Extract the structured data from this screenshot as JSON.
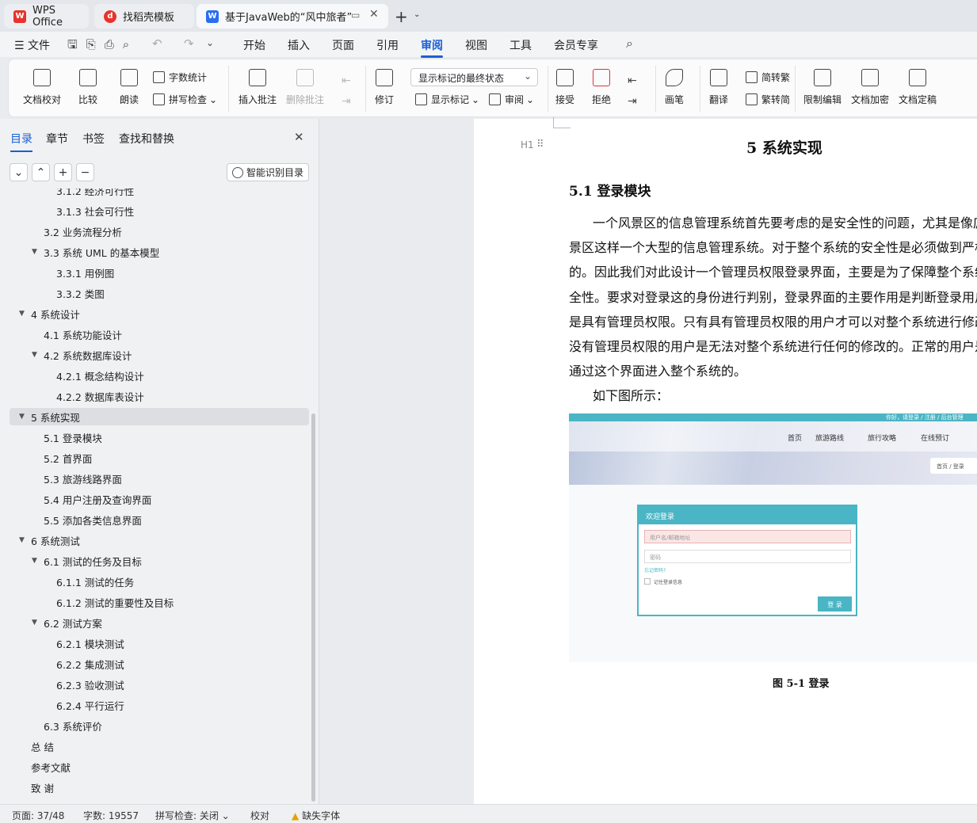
{
  "tabs": [
    {
      "label": "WPS Office"
    },
    {
      "label": "找稻壳模板"
    },
    {
      "label": "基于JavaWeb的“风中旅者”"
    }
  ],
  "menubar": {
    "file": "文件",
    "items": [
      "开始",
      "插入",
      "页面",
      "引用",
      "审阅",
      "视图",
      "工具",
      "会员专享"
    ],
    "selected": "审阅"
  },
  "ribbon": {
    "doc_check": "文档校对",
    "compare": "比较",
    "read_aloud": "朗读",
    "word_count": "字数统计",
    "spell_check": "拼写检查",
    "insert_comment": "插入批注",
    "delete_comment": "删除批注",
    "revise": "修订",
    "display_state": "显示标记的最终状态",
    "show_markup": "显示标记",
    "review": "审阅",
    "accept": "接受",
    "reject": "拒绝",
    "draw": "画笔",
    "translate": "翻译",
    "to_traditional": "简转繁",
    "to_simplified": "繁转简",
    "restrict_edit": "限制编辑",
    "encrypt": "文档加密",
    "finalize": "文档定稿"
  },
  "sidebar": {
    "tabs": [
      "目录",
      "章节",
      "书签",
      "查找和替换"
    ],
    "smart_toc": "智能识别目录",
    "toc": [
      {
        "label": "3.1.2  经济可行性",
        "level": 3
      },
      {
        "label": "3.1.3  社会可行性",
        "level": 3
      },
      {
        "label": "3.2  业务流程分析",
        "level": 2
      },
      {
        "label": "3.3  系统 UML 的基本模型",
        "level": 2,
        "expanded": true
      },
      {
        "label": "3.3.1  用例图",
        "level": 3
      },
      {
        "label": "3.3.2  类图",
        "level": 3
      },
      {
        "label": "4  系统设计",
        "level": 1,
        "expanded": true
      },
      {
        "label": "4.1  系统功能设计",
        "level": 2
      },
      {
        "label": "4.2  系统数据库设计",
        "level": 2,
        "expanded": true
      },
      {
        "label": "4.2.1  概念结构设计",
        "level": 3
      },
      {
        "label": "4.2.2  数据库表设计",
        "level": 3
      },
      {
        "label": "5  系统实现",
        "level": 1,
        "expanded": true,
        "highlight": true
      },
      {
        "label": "5.1 登录模块",
        "level": 2
      },
      {
        "label": "5.2  首界面",
        "level": 2
      },
      {
        "label": "5.3  旅游线路界面",
        "level": 2
      },
      {
        "label": "5.4  用户注册及查询界面",
        "level": 2
      },
      {
        "label": "5.5  添加各类信息界面",
        "level": 2
      },
      {
        "label": "6  系统测试",
        "level": 1,
        "expanded": true
      },
      {
        "label": "6.1 测试的任务及目标",
        "level": 2,
        "expanded": true
      },
      {
        "label": "6.1.1 测试的任务",
        "level": 3
      },
      {
        "label": "6.1.2 测试的重要性及目标",
        "level": 3
      },
      {
        "label": "6.2 测试方案",
        "level": 2,
        "expanded": true
      },
      {
        "label": "6.2.1 模块测试",
        "level": 3
      },
      {
        "label": "6.2.2 集成测试",
        "level": 3
      },
      {
        "label": "6.2.3 验收测试",
        "level": 3
      },
      {
        "label": "6.2.4 平行运行",
        "level": 3
      },
      {
        "label": "6.3 系统评价",
        "level": 2
      },
      {
        "label": "总    结",
        "level": 1
      },
      {
        "label": "参考文献",
        "level": 1
      },
      {
        "label": "致    谢",
        "level": 1
      }
    ]
  },
  "document": {
    "heading_marker": "H1",
    "chapter_title": "5  系统实现",
    "section_title": "5.1 登录模块",
    "lines": [
      "一个风景区的信息管理系统首先要考虑的是安全性的问题，尤其是像庐",
      "景区这样一个大型的信息管理系统。对于整个系统的安全性是必须做到严格",
      "的。因此我们对此设计一个管理员权限登录界面，主要是为了保障整个系统",
      "全性。要求对登录这的身份进行判别，登录界面的主要作用是判断登录用户",
      "是具有管理员权限。只有具有管理员权限的用户才可以对整个系统进行修改",
      "没有管理员权限的用户是无法对整个系统进行任何的修改的。正常的用户是",
      "通过这个界面进入整个系统的。"
    ],
    "as_shown": "如下图所示：",
    "caption": "图 5-1 登录",
    "figure": {
      "top_links": "你好，请登录 / 注册 / 后台管理",
      "nav": [
        "首页",
        "旅游路线",
        "旅行攻略",
        "在线预订"
      ],
      "breadcrumb": "首页  /  登录",
      "panel_title": "欢迎登录",
      "user_placeholder": "用户名/邮箱地址",
      "pwd_placeholder": "密码",
      "forgot": "忘记密码?",
      "remember": "记住登录信息",
      "login_btn": "登 录"
    }
  },
  "status": {
    "page": "页面: 37/48",
    "words": "字数: 19557",
    "spell": "拼写检查: 关闭",
    "proof": "校对",
    "missing_font": "缺失字体"
  },
  "colors": {
    "accent": "#1a5fd6",
    "wps_red": "#e8322c",
    "teal": "#4ab5c4"
  }
}
